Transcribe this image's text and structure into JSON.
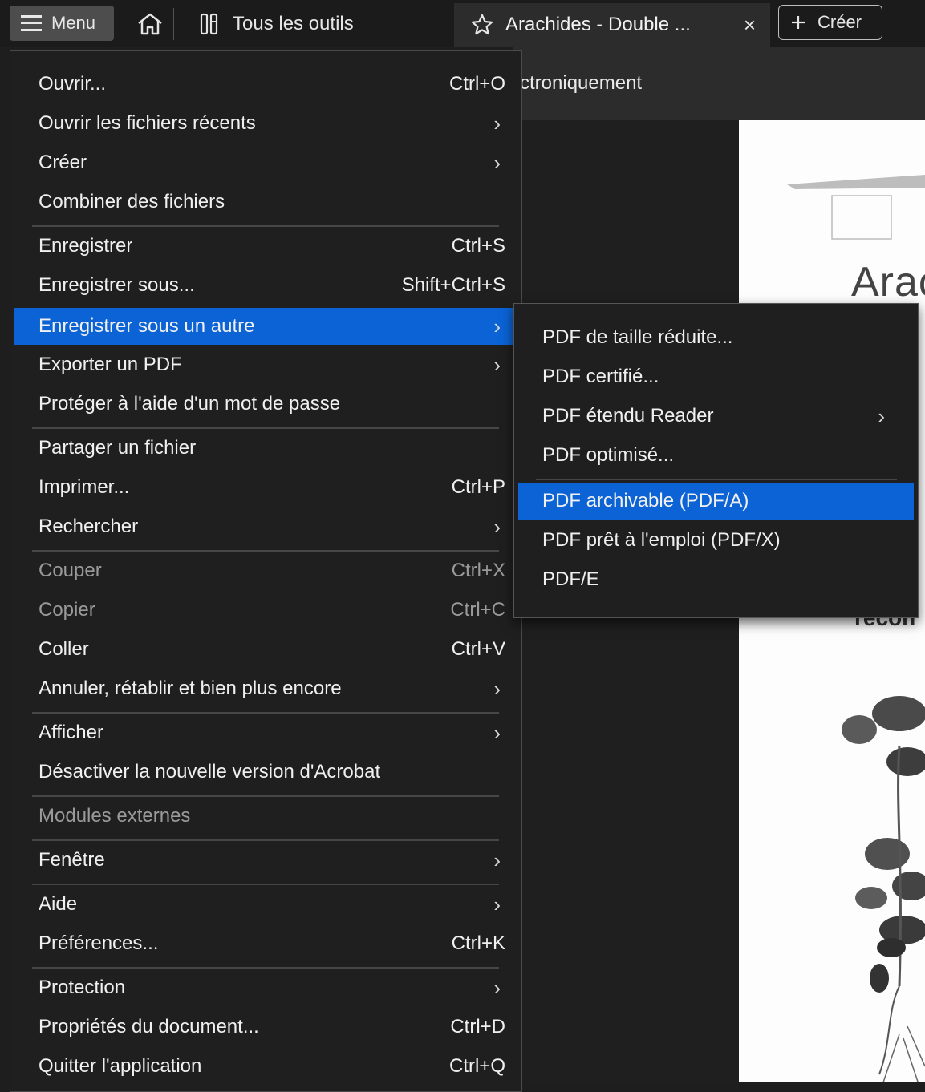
{
  "topbar": {
    "menu_label": "Menu",
    "tools_label": "Tous les outils",
    "tab_title": "Arachides - Double ...",
    "tab_close": "×",
    "create_label": "Créer"
  },
  "toolbar_partial_text": "ctroniquement",
  "document": {
    "title_fragment": "Arac",
    "text_fragment": "recon"
  },
  "main_menu": {
    "items": [
      {
        "label": "Ouvrir...",
        "shortcut": "Ctrl+O"
      },
      {
        "label": "Ouvrir les fichiers récents",
        "submenu": "›"
      },
      {
        "label": "Créer",
        "submenu": "›"
      },
      {
        "label": "Combiner des fichiers"
      },
      {
        "label": "Enregistrer",
        "shortcut": "Ctrl+S"
      },
      {
        "label": "Enregistrer sous...",
        "shortcut": "Shift+Ctrl+S"
      },
      {
        "label": "Enregistrer sous un autre",
        "submenu": "›"
      },
      {
        "label": "Exporter un PDF",
        "submenu": "›"
      },
      {
        "label": "Protéger à l'aide d'un mot de passe"
      },
      {
        "label": "Partager un fichier"
      },
      {
        "label": "Imprimer...",
        "shortcut": "Ctrl+P"
      },
      {
        "label": "Rechercher",
        "submenu": "›"
      },
      {
        "label": "Couper",
        "shortcut": "Ctrl+X"
      },
      {
        "label": "Copier",
        "shortcut": "Ctrl+C"
      },
      {
        "label": "Coller",
        "shortcut": "Ctrl+V"
      },
      {
        "label": "Annuler, rétablir et bien plus encore",
        "submenu": "›"
      },
      {
        "label": "Afficher",
        "submenu": "›"
      },
      {
        "label": "Désactiver la nouvelle version d'Acrobat"
      },
      {
        "label": "Modules externes"
      },
      {
        "label": "Fenêtre",
        "submenu": "›"
      },
      {
        "label": "Aide",
        "submenu": "›"
      },
      {
        "label": "Préférences...",
        "shortcut": "Ctrl+K"
      },
      {
        "label": "Protection",
        "submenu": "›"
      },
      {
        "label": "Propriétés du document...",
        "shortcut": "Ctrl+D"
      },
      {
        "label": "Quitter l'application",
        "shortcut": "Ctrl+Q"
      }
    ]
  },
  "sub_menu": {
    "items": [
      {
        "label": "PDF de taille réduite..."
      },
      {
        "label": "PDF certifié..."
      },
      {
        "label": "PDF étendu Reader",
        "submenu": "›"
      },
      {
        "label": "PDF optimisé..."
      },
      {
        "label": "PDF archivable (PDF/A)"
      },
      {
        "label": "PDF prêt à l'emploi (PDF/X)"
      },
      {
        "label": "PDF/E"
      }
    ]
  },
  "colors": {
    "highlight": "#0b63d6",
    "menu_bg": "#1f1f1f",
    "disabled_text": "#9a9a9a"
  }
}
